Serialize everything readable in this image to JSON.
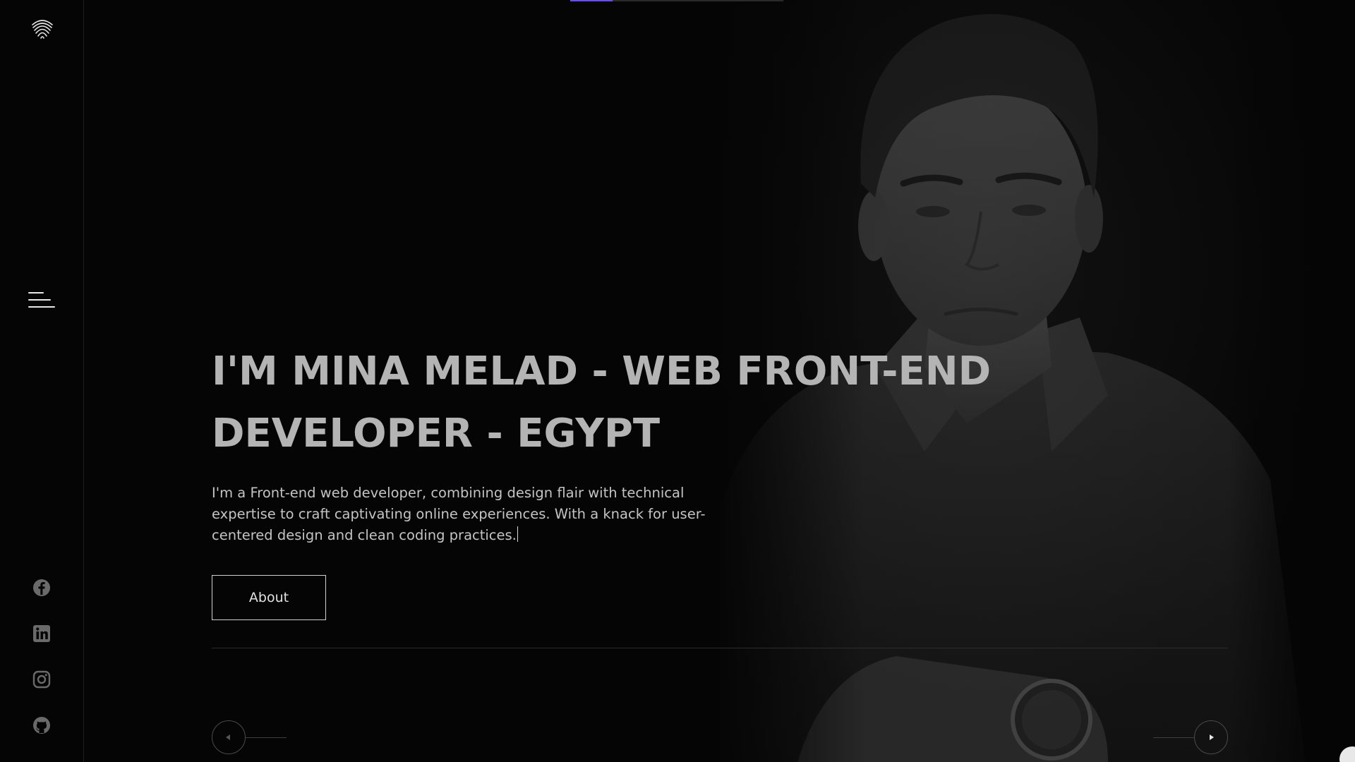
{
  "top_progress": {
    "fraction": 0.2
  },
  "sidebar": {
    "logo": "fingerprint-logo-icon",
    "menu": "hamburger-menu-icon",
    "social": [
      {
        "name": "facebook-icon"
      },
      {
        "name": "linkedin-icon"
      },
      {
        "name": "instagram-icon"
      },
      {
        "name": "github-icon"
      }
    ]
  },
  "hero": {
    "title": "I'M MINA MELAD - WEB FRONT-END DEVELOPER - EGYPT",
    "description": "I'm a Front-end web developer, combining design flair with technical expertise to craft captivating online experiences. With a knack for user-centered design and clean coding practices.",
    "cta_label": "About",
    "photo": "portrait-photo"
  },
  "slider": {
    "prev": "prev-slide-icon",
    "next": "next-slide-icon"
  },
  "colors": {
    "background": "#050505",
    "accent": "#6a4cff",
    "title": "#b4b4b4",
    "text": "#c4c4c4"
  }
}
